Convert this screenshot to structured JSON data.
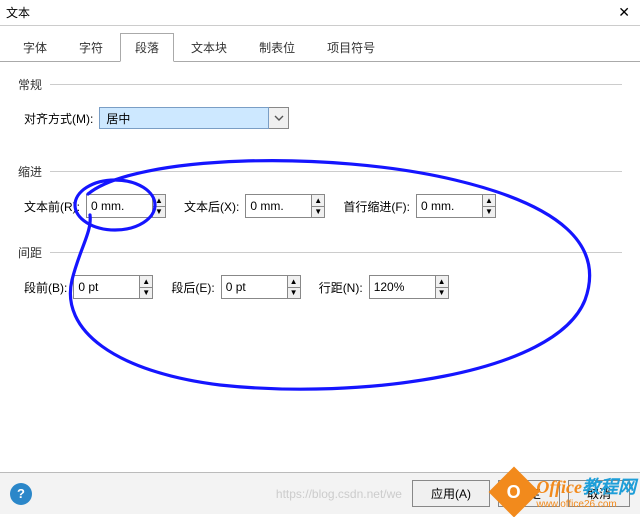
{
  "title": "文本",
  "tabs": [
    "字体",
    "字符",
    "段落",
    "文本块",
    "制表位",
    "项目符号"
  ],
  "active_tab_index": 2,
  "sections": {
    "general": {
      "title": "常规",
      "align_label": "对齐方式(M):",
      "align_value": "居中"
    },
    "indent": {
      "title": "缩进",
      "before_label": "文本前(R):",
      "before_value": "0 mm.",
      "after_label": "文本后(X):",
      "after_value": "0 mm.",
      "first_label": "首行缩进(F):",
      "first_value": "0 mm."
    },
    "spacing": {
      "title": "间距",
      "before_label": "段前(B):",
      "before_value": "0 pt",
      "after_label": "段后(E):",
      "after_value": "0 pt",
      "line_label": "行距(N):",
      "line_value": "120%"
    }
  },
  "footer": {
    "apply": "应用(A)",
    "ok": "确定",
    "cancel": "取消",
    "ghost_url": "https://blog.csdn.net/we"
  },
  "watermark": {
    "brand_orange": "Office",
    "brand_blue": "教程网",
    "url": "www.office26.com"
  }
}
